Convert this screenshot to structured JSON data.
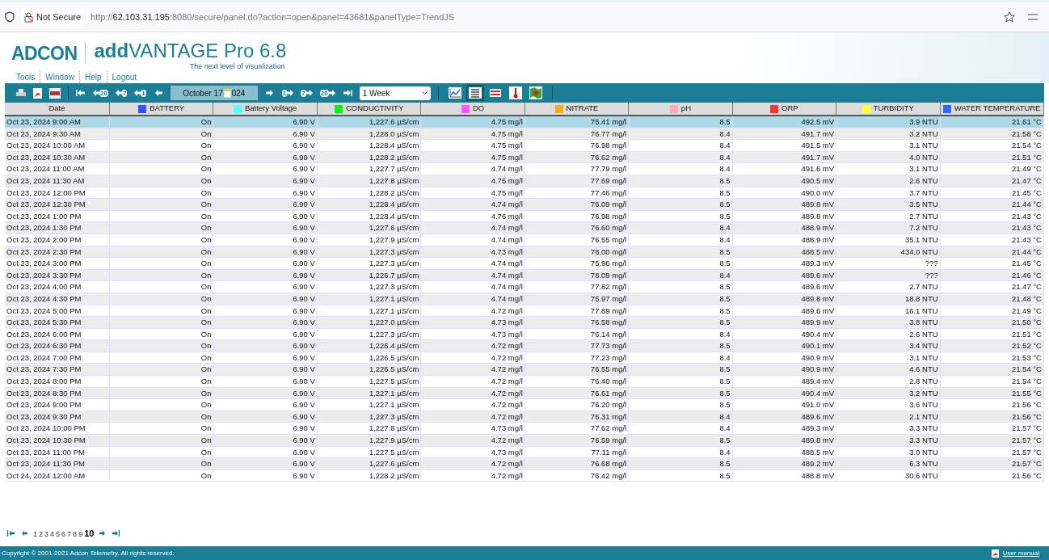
{
  "browser": {
    "security": "Not Secure",
    "url": "http://**62.103.31.195**:8080/secure/panel.do?action=open&panel=43681&panelType=TrendJS"
  },
  "header": {
    "logo": "ADCON",
    "product_bold": "add",
    "product": "VANTAGE Pro 6.8",
    "tagline": "The next level of visualization",
    "menu": [
      "Tools",
      "Window",
      "Help",
      "Logout"
    ]
  },
  "toolbar": {
    "date_start": "October 17",
    "date_end": "024",
    "period": "1 Week",
    "views": [
      {
        "kind": "chart",
        "selected": false
      },
      {
        "kind": "table",
        "selected": true
      },
      {
        "kind": "flag",
        "selected": false
      },
      {
        "kind": "thermo",
        "selected": false
      },
      {
        "kind": "map",
        "selected": false
      }
    ],
    "step_back": [
      "20",
      "7",
      "1"
    ],
    "step_fwd": [
      "1",
      "7",
      "20"
    ]
  },
  "table": {
    "columns": [
      {
        "label": "Date"
      },
      {
        "label": "BATTERY",
        "color": "#3355ff"
      },
      {
        "label": "Battery Voltage",
        "color": "#55ffff"
      },
      {
        "label": "CONDUCTIVITY",
        "color": "#11ee11"
      },
      {
        "label": "DO",
        "color": "#ff55ff"
      },
      {
        "label": "NITRATE",
        "color": "#ffaa11"
      },
      {
        "label": "pH",
        "color": "#ffaabb"
      },
      {
        "label": "ORP",
        "color": "#ff3333"
      },
      {
        "label": "TURBIDITY",
        "color": "#ffff33"
      },
      {
        "label": "WATER TEMPERATURE",
        "color": "#3366ff"
      }
    ],
    "rows": [
      {
        "selected": true,
        "cells": [
          "Oct 23, 2024 9:00 AM",
          "On",
          "6.90 V",
          "1,227.6 µS/cm",
          "4.75 mg/l",
          "75.41 mg/l",
          "8.5",
          "492.5 mV",
          "3.9 NTU",
          "21.61 °C"
        ]
      },
      {
        "selected": false,
        "cells": [
          "Oct 23, 2024 9:30 AM",
          "On",
          "6.90 V",
          "1,228.0 µS/cm",
          "4.75 mg/l",
          "76.77 mg/l",
          "8.4",
          "491.7 mV",
          "3.2 NTU",
          "21.58 °C"
        ]
      },
      {
        "selected": false,
        "cells": [
          "Oct 23, 2024 10:00 AM",
          "On",
          "6.90 V",
          "1,228.4 µS/cm",
          "4.75 mg/l",
          "76.98 mg/l",
          "8.4",
          "491.5 mV",
          "3.1 NTU",
          "21.54 °C"
        ]
      },
      {
        "selected": false,
        "cells": [
          "Oct 23, 2024 10:30 AM",
          "On",
          "6.90 V",
          "1,228.2 µS/cm",
          "4.75 mg/l",
          "76.62 mg/l",
          "8.4",
          "491.7 mV",
          "4.0 NTU",
          "21.51 °C"
        ]
      },
      {
        "selected": false,
        "cells": [
          "Oct 23, 2024 11:00 AM",
          "On",
          "6.90 V",
          "1,227.7 µS/cm",
          "4.74 mg/l",
          "77.79 mg/l",
          "8.4",
          "491.6 mV",
          "3.1 NTU",
          "21.49 °C"
        ]
      },
      {
        "selected": false,
        "cells": [
          "Oct 23, 2024 11:30 AM",
          "On",
          "6.90 V",
          "1,227.8 µS/cm",
          "4.75 mg/l",
          "77.69 mg/l",
          "8.5",
          "490.5 mV",
          "2.6 NTU",
          "21.47 °C"
        ]
      },
      {
        "selected": false,
        "cells": [
          "Oct 23, 2024 12:00 PM",
          "On",
          "6.90 V",
          "1,228.2 µS/cm",
          "4.75 mg/l",
          "77.46 mg/l",
          "8.5",
          "490.0 mV",
          "3.7 NTU",
          "21.45 °C"
        ]
      },
      {
        "selected": false,
        "cells": [
          "Oct 23, 2024 12:30 PM",
          "On",
          "6.90 V",
          "1,228.4 µS/cm",
          "4.74 mg/l",
          "76.09 mg/l",
          "8.5",
          "489.8 mV",
          "3.5 NTU",
          "21.44 °C"
        ]
      },
      {
        "selected": false,
        "cells": [
          "Oct 23, 2024 1:00 PM",
          "On",
          "6.90 V",
          "1,228.4 µS/cm",
          "4.76 mg/l",
          "76.98 mg/l",
          "8.5",
          "489.8 mV",
          "2.7 NTU",
          "21.43 °C"
        ]
      },
      {
        "selected": false,
        "cells": [
          "Oct 23, 2024 1:30 PM",
          "On",
          "6.90 V",
          "1,227.6 µS/cm",
          "4.74 mg/l",
          "76.60 mg/l",
          "8.4",
          "488.9 mV",
          "7.2 NTU",
          "21.43 °C"
        ]
      },
      {
        "selected": false,
        "cells": [
          "Oct 23, 2024 2:00 PM",
          "On",
          "6.90 V",
          "1,227.9 µS/cm",
          "4.74 mg/l",
          "76.55 mg/l",
          "8.4",
          "488.9 mV",
          "35.1 NTU",
          "21.43 °C"
        ]
      },
      {
        "selected": false,
        "cells": [
          "Oct 23, 2024 2:30 PM",
          "On",
          "6.90 V",
          "1,227.3 µS/cm",
          "4.73 mg/l",
          "78.00 mg/l",
          "8.5",
          "488.5 mV",
          "434.0 NTU",
          "21.44 °C"
        ]
      },
      {
        "selected": false,
        "cells": [
          "Oct 23, 2024 3:00 PM",
          "On",
          "6.90 V",
          "1,227.3 µS/cm",
          "4.74 mg/l",
          "75.96 mg/l",
          "8.5",
          "489.3 mV",
          "???",
          "21.45 °C"
        ]
      },
      {
        "selected": false,
        "cells": [
          "Oct 23, 2024 3:30 PM",
          "On",
          "6.90 V",
          "1,226.7 µS/cm",
          "4.74 mg/l",
          "78.09 mg/l",
          "8.4",
          "489.6 mV",
          "???",
          "21.46 °C"
        ]
      },
      {
        "selected": false,
        "cells": [
          "Oct 23, 2024 4:00 PM",
          "On",
          "6.90 V",
          "1,227.3 µS/cm",
          "4.74 mg/l",
          "77.82 mg/l",
          "8.5",
          "489.6 mV",
          "2.7 NTU",
          "21.47 °C"
        ]
      },
      {
        "selected": false,
        "cells": [
          "Oct 23, 2024 4:30 PM",
          "On",
          "6.90 V",
          "1,227.1 µS/cm",
          "4.74 mg/l",
          "75.97 mg/l",
          "8.5",
          "489.8 mV",
          "18.8 NTU",
          "21.48 °C"
        ]
      },
      {
        "selected": false,
        "cells": [
          "Oct 23, 2024 5:00 PM",
          "On",
          "6.90 V",
          "1,227.1 µS/cm",
          "4.72 mg/l",
          "77.89 mg/l",
          "8.5",
          "489.6 mV",
          "16.1 NTU",
          "21.49 °C"
        ]
      },
      {
        "selected": false,
        "cells": [
          "Oct 23, 2024 5:30 PM",
          "On",
          "6.90 V",
          "1,227.0 µS/cm",
          "4.73 mg/l",
          "76.58 mg/l",
          "8.5",
          "489.9 mV",
          "3.8 NTU",
          "21.50 °C"
        ]
      },
      {
        "selected": false,
        "cells": [
          "Oct 23, 2024 6:00 PM",
          "On",
          "6.90 V",
          "1,227.3 µS/cm",
          "4.73 mg/l",
          "76.14 mg/l",
          "8.4",
          "490.4 mV",
          "2.6 NTU",
          "21.51 °C"
        ]
      },
      {
        "selected": false,
        "cells": [
          "Oct 23, 2024 6:30 PM",
          "On",
          "6.90 V",
          "1,226.4 µS/cm",
          "4.72 mg/l",
          "77.73 mg/l",
          "8.5",
          "490.1 mV",
          "3.4 NTU",
          "21.52 °C"
        ]
      },
      {
        "selected": false,
        "cells": [
          "Oct 23, 2024 7:00 PM",
          "On",
          "6.90 V",
          "1,226.5 µS/cm",
          "4.72 mg/l",
          "77.23 mg/l",
          "8.4",
          "490.9 mV",
          "3.1 NTU",
          "21.53 °C"
        ]
      },
      {
        "selected": false,
        "cells": [
          "Oct 23, 2024 7:30 PM",
          "On",
          "6.90 V",
          "1,226.5 µS/cm",
          "4.72 mg/l",
          "76.55 mg/l",
          "8.5",
          "490.9 mV",
          "4.6 NTU",
          "21.54 °C"
        ]
      },
      {
        "selected": false,
        "cells": [
          "Oct 23, 2024 8:00 PM",
          "On",
          "6.90 V",
          "1,227.5 µS/cm",
          "4.72 mg/l",
          "76.40 mg/l",
          "8.5",
          "489.4 mV",
          "2.8 NTU",
          "21.54 °C"
        ]
      },
      {
        "selected": false,
        "cells": [
          "Oct 23, 2024 8:30 PM",
          "On",
          "6.90 V",
          "1,227.1 µS/cm",
          "4.72 mg/l",
          "76.61 mg/l",
          "8.5",
          "490.4 mV",
          "3.2 NTU",
          "21.55 °C"
        ]
      },
      {
        "selected": false,
        "cells": [
          "Oct 23, 2024 9:00 PM",
          "On",
          "6.90 V",
          "1,227.1 µS/cm",
          "4.72 mg/l",
          "76.20 mg/l",
          "8.5",
          "491.0 mV",
          "3.6 NTU",
          "21.56 °C"
        ]
      },
      {
        "selected": false,
        "cells": [
          "Oct 23, 2024 9:30 PM",
          "On",
          "6.90 V",
          "1,227.3 µS/cm",
          "4.72 mg/l",
          "76.31 mg/l",
          "8.4",
          "489.6 mV",
          "2.1 NTU",
          "21.56 °C"
        ]
      },
      {
        "selected": false,
        "cells": [
          "Oct 23, 2024 10:00 PM",
          "On",
          "6.90 V",
          "1,227.8 µS/cm",
          "4.73 mg/l",
          "77.62 mg/l",
          "8.4",
          "489.3 mV",
          "3.3 NTU",
          "21.57 °C"
        ]
      },
      {
        "selected": false,
        "cells": [
          "Oct 23, 2024 10:30 PM",
          "On",
          "6.90 V",
          "1,227.9 µS/cm",
          "4.72 mg/l",
          "76.59 mg/l",
          "8.5",
          "489.8 mV",
          "3.3 NTU",
          "21.57 °C"
        ]
      },
      {
        "selected": false,
        "cells": [
          "Oct 23, 2024 11:00 PM",
          "On",
          "6.90 V",
          "1,227.5 µS/cm",
          "4.73 mg/l",
          "77.11 mg/l",
          "8.4",
          "488.5 mV",
          "3.0 NTU",
          "21.57 °C"
        ]
      },
      {
        "selected": false,
        "cells": [
          "Oct 23, 2024 11:30 PM",
          "On",
          "6.90 V",
          "1,227.6 µS/cm",
          "4.72 mg/l",
          "76.68 mg/l",
          "8.5",
          "489.2 mV",
          "6.3 NTU",
          "21.57 °C"
        ]
      },
      {
        "selected": false,
        "cells": [
          "Oct 24, 2024 12:00 AM",
          "On",
          "6.90 V",
          "1,228.2 µS/cm",
          "4.72 mg/l",
          "76.42 mg/l",
          "8.5",
          "488.8 mV",
          "30.6 NTU",
          "21.56 °C"
        ]
      }
    ]
  },
  "pagination": [
    {
      "label": "1",
      "selected": false
    },
    {
      "label": "2",
      "selected": false
    },
    {
      "label": "3",
      "selected": false
    },
    {
      "label": "4",
      "selected": false
    },
    {
      "label": "5",
      "selected": false
    },
    {
      "label": "6",
      "selected": false
    },
    {
      "label": "7",
      "selected": false
    },
    {
      "label": "8",
      "selected": false
    },
    {
      "label": "9",
      "selected": false
    },
    {
      "label": "10",
      "selected": true
    }
  ],
  "footer": {
    "copyright": "Copyright © 2001-2021 Adcon Telemetry. All rights reserved.",
    "manual": "User manual"
  }
}
